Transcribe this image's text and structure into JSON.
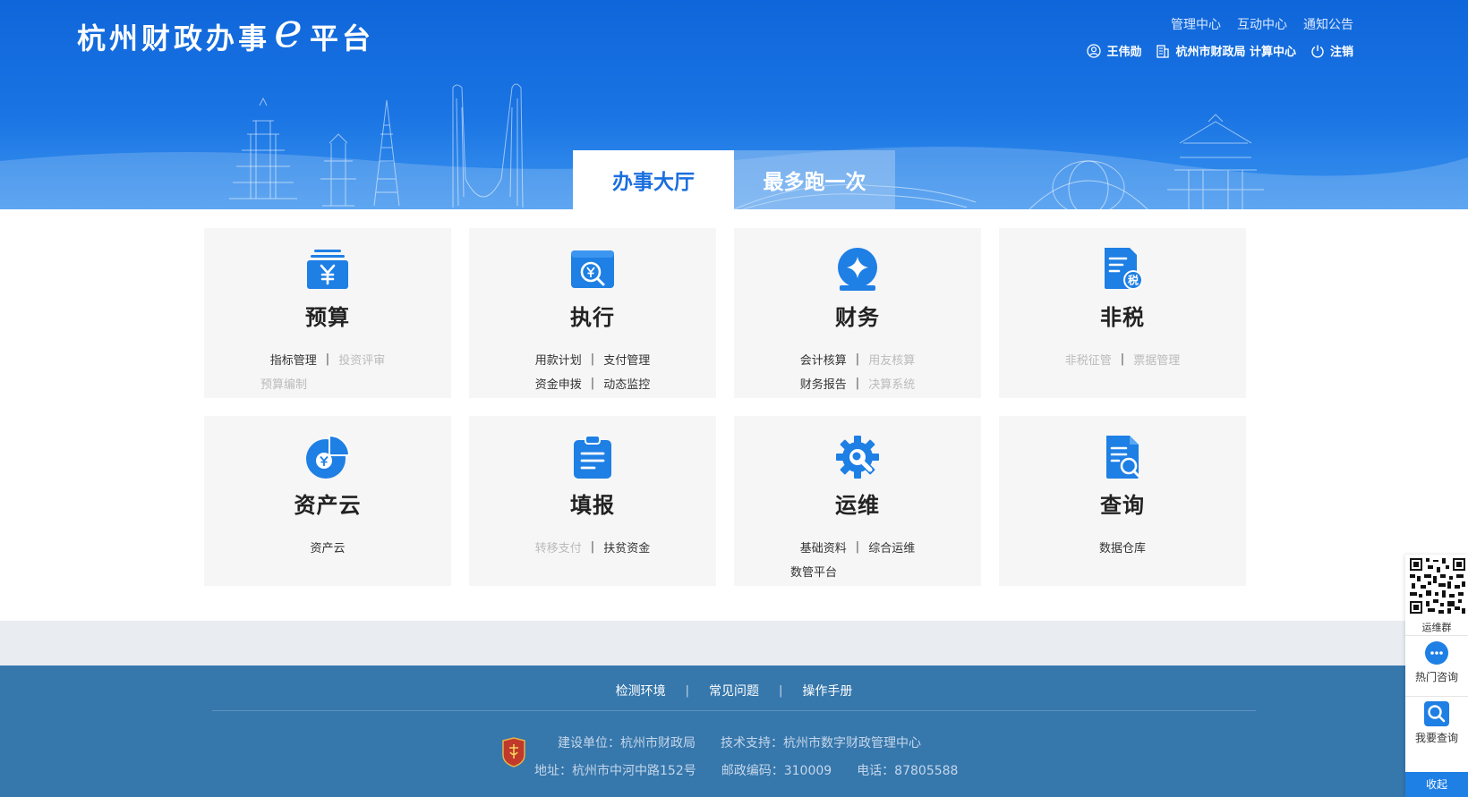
{
  "header": {
    "logo_text_1": "杭州财政办事",
    "logo_e": "e",
    "logo_text_2": "平台",
    "top_links": [
      "管理中心",
      "互动中心",
      "通知公告"
    ],
    "user_name": "王伟勋",
    "org": "杭州市财政局 计算中心",
    "logout": "注销"
  },
  "tabs": [
    {
      "label": "办事大厅",
      "active": true
    },
    {
      "label": "最多跑一次",
      "active": false
    }
  ],
  "cards": [
    {
      "title": "预算",
      "icon": "budget-yuan-icon",
      "rows": [
        [
          {
            "text": "指标管理",
            "enabled": true
          },
          {
            "text": "投资评审",
            "enabled": false
          }
        ],
        [
          {
            "text": "预算编制",
            "enabled": false
          }
        ]
      ]
    },
    {
      "title": "执行",
      "icon": "execution-search-yuan-icon",
      "rows": [
        [
          {
            "text": "用款计划",
            "enabled": true
          },
          {
            "text": "支付管理",
            "enabled": true
          }
        ],
        [
          {
            "text": "资金申拨",
            "enabled": true
          },
          {
            "text": "动态监控",
            "enabled": true
          }
        ]
      ]
    },
    {
      "title": "财务",
      "icon": "finance-star-icon",
      "rows": [
        [
          {
            "text": "会计核算",
            "enabled": true
          },
          {
            "text": "用友核算",
            "enabled": false
          }
        ],
        [
          {
            "text": "财务报告",
            "enabled": true
          },
          {
            "text": "决算系统",
            "enabled": false
          }
        ]
      ]
    },
    {
      "title": "非税",
      "icon": "tax-document-icon",
      "rows": [
        [
          {
            "text": "非税征管",
            "enabled": false
          },
          {
            "text": "票据管理",
            "enabled": false
          }
        ]
      ]
    },
    {
      "title": "资产云",
      "icon": "asset-pie-icon",
      "rows": [
        [
          {
            "text": "资产云",
            "enabled": true
          }
        ]
      ]
    },
    {
      "title": "填报",
      "icon": "clipboard-icon",
      "rows": [
        [
          {
            "text": "转移支付",
            "enabled": false
          },
          {
            "text": "扶贫资金",
            "enabled": true
          }
        ]
      ]
    },
    {
      "title": "运维",
      "icon": "gear-wrench-icon",
      "rows": [
        [
          {
            "text": "基础资料",
            "enabled": true
          },
          {
            "text": "综合运维",
            "enabled": true
          }
        ],
        [
          {
            "text": "数管平台",
            "enabled": true
          }
        ]
      ]
    },
    {
      "title": "查询",
      "icon": "document-search-icon",
      "rows": [
        [
          {
            "text": "数据仓库",
            "enabled": true
          }
        ]
      ]
    }
  ],
  "footer": {
    "links": [
      "检测环境",
      "常见问题",
      "操作手册"
    ],
    "separator": "|",
    "builder": "建设单位：杭州市财政局",
    "support": "技术支持：杭州市数字财政管理中心",
    "address": "地址：杭州市中河中路152号",
    "postcode": "邮政编码：310009",
    "phone": "电话：87805588"
  },
  "side": {
    "qr_caption": "运维群",
    "hot_consult": "热门咨询",
    "query": "我要查询",
    "collapse": "收起"
  },
  "colors": {
    "header_blue": "#1a6fde",
    "icon_blue": "#1e7fe4",
    "footer_blue": "#3677ac",
    "card_bg": "#f6f6f7",
    "disabled_text": "#bbbbbb"
  }
}
